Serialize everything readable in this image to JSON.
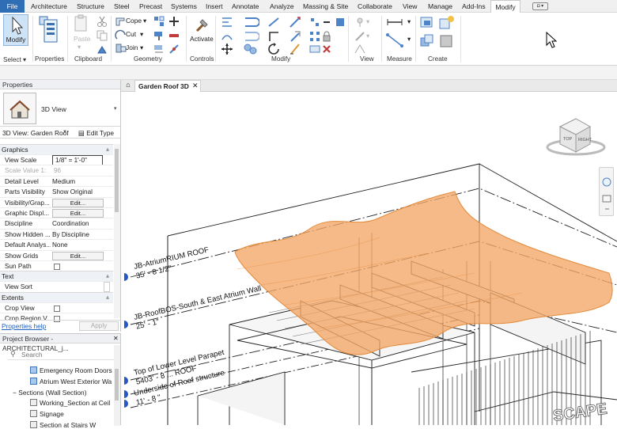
{
  "ribbon_tabs": [
    "File",
    "Architecture",
    "Structure",
    "Steel",
    "Precast",
    "Systems",
    "Insert",
    "Annotate",
    "Analyze",
    "Massing & Site",
    "Collaborate",
    "View",
    "Manage",
    "Add-Ins",
    "Modify"
  ],
  "ribbon": {
    "select": {
      "modify_label": "Modify",
      "panel": "Select",
      "panel_caret": "▾"
    },
    "properties": {
      "panel": "Properties"
    },
    "clipboard": {
      "paste": "Paste",
      "panel": "Clipboard"
    },
    "geometry": {
      "cope": "Cope",
      "cut": "Cut",
      "join": "Join",
      "panel": "Geometry"
    },
    "controls": {
      "activate": "Activate",
      "panel": "Controls"
    },
    "modify": {
      "panel": "Modify"
    },
    "view": {
      "panel": "View"
    },
    "measure": {
      "panel": "Measure"
    },
    "create": {
      "panel": "Create"
    }
  },
  "properties": {
    "title": "Properties",
    "type_name": "3D View",
    "instance": "3D View: Garden Roof",
    "edit_type": "Edit Type",
    "groups": {
      "graphics": "Graphics",
      "text": "Text",
      "extents": "Extents"
    },
    "rows": [
      {
        "name": "View Scale",
        "value": "1/8\" = 1'-0\""
      },
      {
        "name": "Scale Value    1:",
        "value": "96"
      },
      {
        "name": "Detail Level",
        "value": "Medium"
      },
      {
        "name": "Parts Visibility",
        "value": "Show Original"
      },
      {
        "name": "Visibility/Grap...",
        "value": "Edit..."
      },
      {
        "name": "Graphic Displ...",
        "value": "Edit..."
      },
      {
        "name": "Discipline",
        "value": "Coordination"
      },
      {
        "name": "Show Hidden ...",
        "value": "By Discipline"
      },
      {
        "name": "Default Analys...",
        "value": "None"
      },
      {
        "name": "Show Grids",
        "value": "Edit..."
      },
      {
        "name": "Sun Path",
        "value": ""
      }
    ],
    "text_rows": [
      {
        "name": "View Sort"
      }
    ],
    "extent_rows": [
      {
        "name": "Crop View"
      },
      {
        "name": "Crop Region V..."
      }
    ],
    "help_link": "Properties help",
    "apply": "Apply"
  },
  "project_browser": {
    "title": "Project Browser - ARCHITECTURAL_j...",
    "close": "✕",
    "search_placeholder": "Search",
    "items": [
      "Emergency Room Doors",
      "Atrium West Exterior Wa",
      "Sections (Wall Section)",
      "Working_Section at Ceil",
      "Signage",
      "Section at Stairs W"
    ]
  },
  "view": {
    "tab_label": "Garden Roof 3D",
    "tab_close": "✕",
    "viewcube": {
      "top": "TOP",
      "right": "RIGHT"
    },
    "levels": [
      {
        "name": "JB-AtriumRIUM ROOF",
        "elev": "35' - 8 1/2\""
      },
      {
        "name": "JB-RoofBOS-South & East Atrium Wall",
        "elev": "25' - 1\""
      },
      {
        "name": "Top of Lower Level Parapet",
        "elev": "5403' - 8 ... ROOF"
      },
      {
        "name": "Underside of Roof structure",
        "elev": "11' - 8 \""
      }
    ],
    "signage": "SCAPE"
  },
  "colors": {
    "file_tab": "#2f6db5",
    "roof_surface": "#f2a765",
    "roof_edge": "#e38a3b",
    "level_marker": "#2657c4"
  }
}
